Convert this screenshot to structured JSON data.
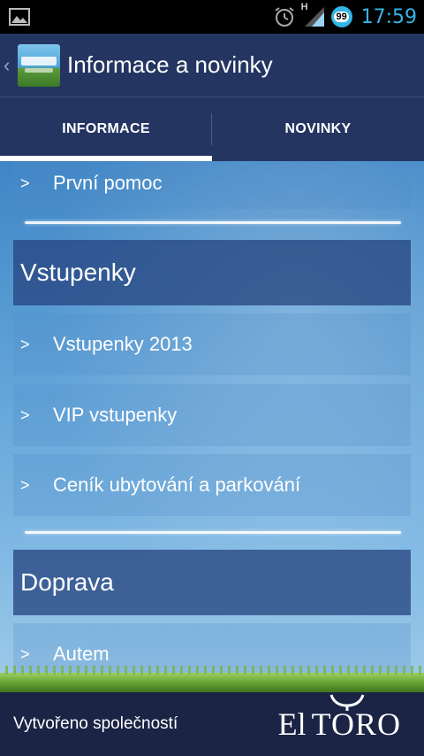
{
  "status_bar": {
    "network_label": "H",
    "notification_badge": "99",
    "time": "17:59"
  },
  "action_bar": {
    "title": "Informace a novinky"
  },
  "tabs": [
    {
      "label": "INFORMACE",
      "active": true
    },
    {
      "label": "NOVINKY",
      "active": false
    }
  ],
  "list": {
    "chevron": ">",
    "first_aid": "První pomoc",
    "section_tickets": "Vstupenky",
    "tickets_2013": "Vstupenky 2013",
    "vip_tickets": "VIP vstupenky",
    "accommodation_prices": "Ceník ubytování a parkování",
    "section_transport": "Doprava",
    "by_car": "Autem"
  },
  "footer": {
    "created_by": "Vytvořeno společností",
    "brand_el": "El",
    "brand_toro": "TORO"
  },
  "colors": {
    "action_bar": "#243562",
    "footer": "#1b2445",
    "status_time": "#33b5e5",
    "section_header": "#28467f"
  }
}
